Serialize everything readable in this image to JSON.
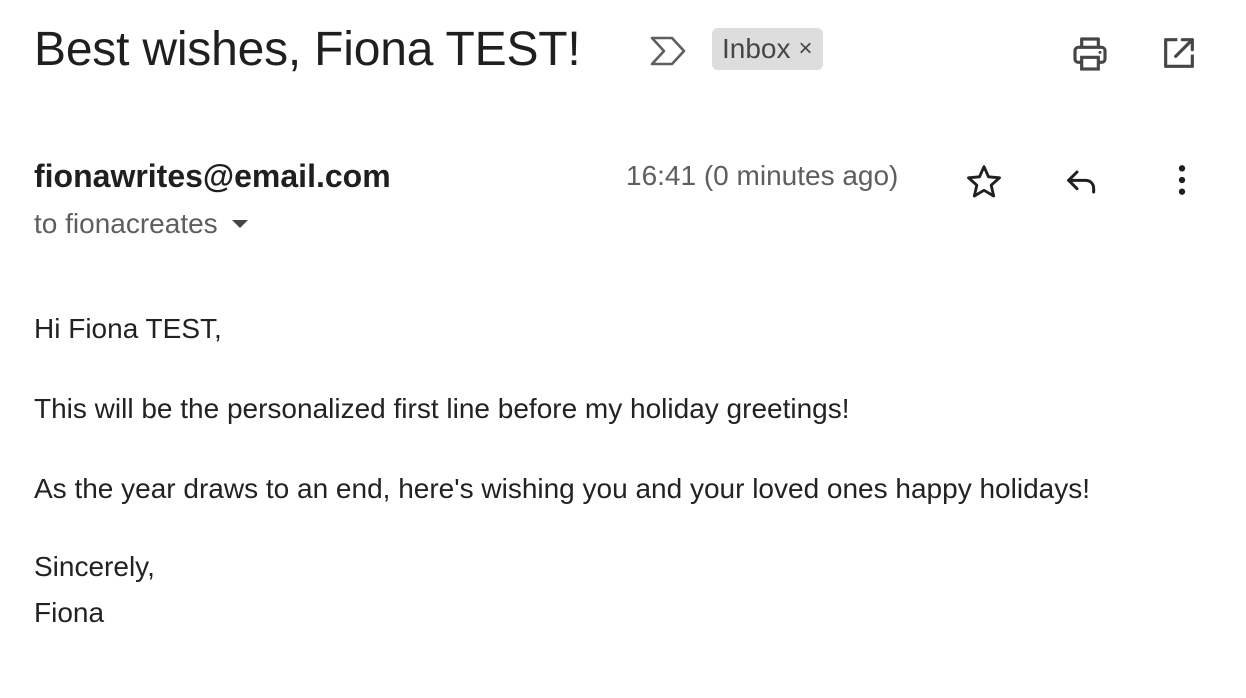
{
  "email": {
    "subject": "Best wishes, Fiona TEST!",
    "label": "Inbox",
    "label_remove": "×",
    "sender": "fionawrites@email.com",
    "time": "16:41 (0 minutes ago)",
    "recipient": "to fionacreates",
    "body": {
      "greeting": "Hi Fiona TEST,",
      "first_line": "This will be the personalized first line before my holiday greetings!",
      "paragraph": "As the year draws to an end, here's wishing you and your loved ones happy holidays!",
      "closing": "Sincerely,",
      "signature": "Fiona"
    }
  },
  "icons": {
    "importance": "importance-marker-icon",
    "print": "print-icon",
    "new_window": "open-in-new-window-icon",
    "star": "star-icon",
    "reply": "reply-icon",
    "more": "more-vertical-icon",
    "recipient_details": "caret-down-icon"
  },
  "colors": {
    "text_primary": "#1f1f1f",
    "text_secondary": "#5e5e5e",
    "chip_background": "#dddddd",
    "icon": "#444746"
  }
}
